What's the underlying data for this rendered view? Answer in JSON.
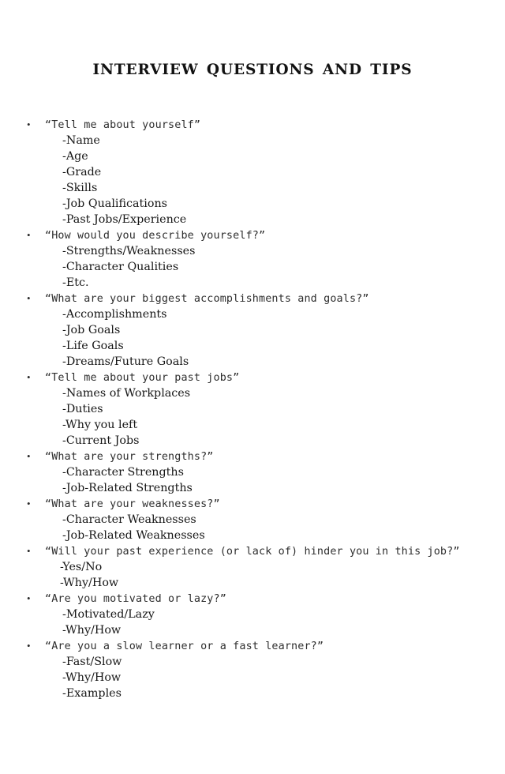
{
  "document": {
    "title": "INTERVIEW  QUESTIONS AND TIPS",
    "bullet_glyph": "•",
    "text_color": "#1a1a1a",
    "background_color": "#ffffff"
  },
  "sections": [
    {
      "question": "“Tell me about yourself”",
      "items": [
        "-Name",
        "-Age",
        "-Grade",
        "-Skills",
        "-Job Qualifications",
        "-Past Jobs/Experience"
      ]
    },
    {
      "question": "“How would you describe yourself?”",
      "items": [
        "-Strengths/Weaknesses",
        "-Character Qualities",
        "-Etc."
      ]
    },
    {
      "question": "“What are your biggest accomplishments and goals?”",
      "items": [
        "-Accomplishments",
        "-Job Goals",
        "-Life Goals",
        "-Dreams/Future Goals"
      ]
    },
    {
      "question": "“Tell me about your past jobs”",
      "items": [
        "-Names of Workplaces",
        "-Duties",
        "-Why you left",
        "-Current Jobs"
      ]
    },
    {
      "question": "“What are your strengths?”",
      "items": [
        "-Character Strengths",
        "-Job-Related Strengths"
      ]
    },
    {
      "question": "“What are your weaknesses?”",
      "items": [
        "-Character Weaknesses",
        "-Job-Related Weaknesses"
      ]
    },
    {
      "question": "“Will your past experience (or lack of) hinder you in this job?”",
      "items": [
        "-Yes/No",
        "-Why/How"
      ],
      "items_indent": "short"
    },
    {
      "question": "“Are you motivated or lazy?”",
      "items": [
        "-Motivated/Lazy",
        "-Why/How"
      ]
    },
    {
      "question": "“Are you a slow learner or a fast learner?”",
      "items": [
        "-Fast/Slow",
        "-Why/How",
        "-Examples"
      ]
    }
  ]
}
